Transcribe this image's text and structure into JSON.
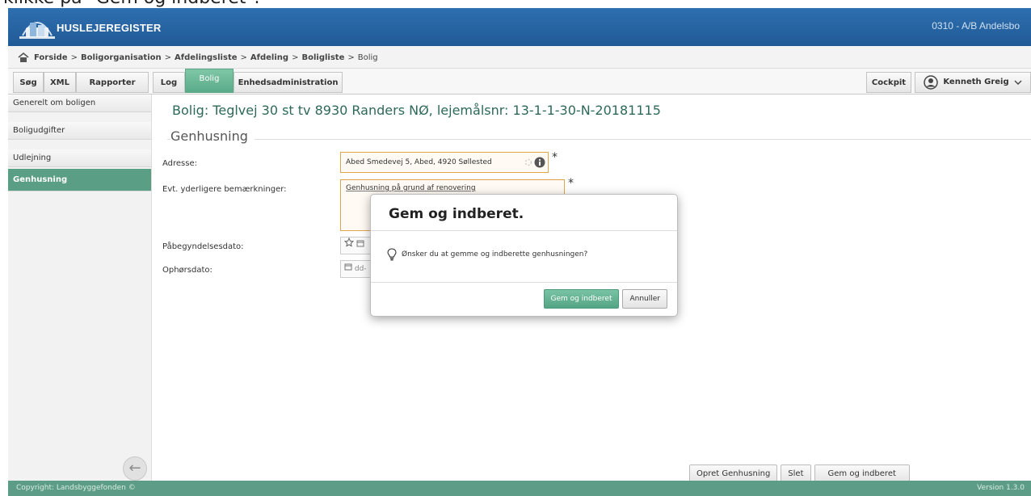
{
  "document_caption": "klikke på \"Gem og indberet\".",
  "app": {
    "logo_text": "HUSLEJEREGISTER",
    "org_name": "0310 - A/B Andelsbo"
  },
  "breadcrumb": {
    "items": [
      "Forside",
      "Boligorganisation",
      "Afdelingsliste",
      "Afdeling",
      "Boligliste",
      "Bolig"
    ],
    "separator": ">"
  },
  "tabs": {
    "left": [
      "Søg",
      "XML",
      "Rapporter"
    ],
    "middle": [
      "Log",
      "Bolig",
      "Enhedsadministration"
    ],
    "active": "Bolig",
    "cockpit": "Cockpit",
    "user": "Kenneth Greig"
  },
  "sidebar": {
    "items": [
      "Generelt om boligen",
      "Boligudgifter",
      "Udlejning",
      "Genhusning"
    ],
    "active": "Genhusning"
  },
  "main": {
    "title": "Bolig: Teglvej 30 st tv 8930 Randers NØ, lejemålsnr: 13-1-1-30-N-20181115",
    "section_title": "Genhusning",
    "labels": {
      "adresse": "Adresse:",
      "bemaerkninger": "Evt. yderligere bemærkninger:",
      "start": "Påbegyndelsesdato:",
      "end": "Ophørsdato:"
    },
    "values": {
      "adresse": "Abed Smedevej 5, Abed, 4920 Søllested",
      "bemaerkninger": "Genhusning på grund af renovering",
      "date_placeholder": "dd-"
    },
    "required_mark": "*"
  },
  "bottom_buttons": [
    "Opret Genhusning",
    "Slet",
    "Gem og indberet"
  ],
  "modal": {
    "title": "Gem og indberet.",
    "message": "Ønsker du at gemme og indberette genhusningen?",
    "confirm": "Gem og indberet",
    "cancel": "Annuller"
  },
  "footer": {
    "copyright": "Copyright: Landsbyggefonden ©",
    "version": "Version 1.3.0"
  },
  "colors": {
    "topbar": "#215a96",
    "accent_green": "#5a9e86",
    "field_border": "#e2a54a"
  }
}
